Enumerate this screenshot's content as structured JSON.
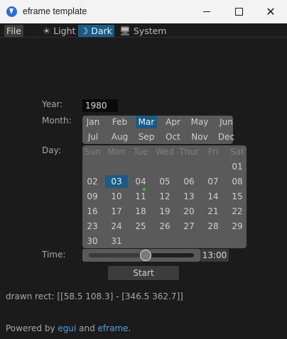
{
  "window": {
    "title": "eframe template"
  },
  "menu": {
    "file": "File",
    "themes": [
      {
        "label": "Light",
        "icon": "☀"
      },
      {
        "label": "Dark",
        "icon": "☽"
      },
      {
        "label": "System",
        "icon": "🖥"
      }
    ],
    "selected_theme": "Dark"
  },
  "form": {
    "year_label": "Year:",
    "year_value": "1980",
    "month_label": "Month:",
    "months": [
      "Jan",
      "Feb",
      "Mar",
      "Apr",
      "May",
      "Jun",
      "Jul",
      "Aug",
      "Sep",
      "Oct",
      "Nov",
      "Dec"
    ],
    "selected_month": "Mar",
    "day_label": "Day:",
    "weekdays": [
      "Sun",
      "Mon",
      "Tue",
      "Wed",
      "Thur",
      "Fri",
      "Sat"
    ],
    "days": [
      "01",
      "02",
      "03",
      "04",
      "05",
      "06",
      "07",
      "08",
      "09",
      "10",
      "11",
      "12",
      "13",
      "14",
      "15",
      "16",
      "17",
      "18",
      "19",
      "20",
      "21",
      "22",
      "23",
      "24",
      "25",
      "26",
      "27",
      "28",
      "29",
      "30",
      "31"
    ],
    "selected_day": "03",
    "today_day": "11",
    "time_label": "Time:",
    "time_value": "13:00",
    "time_fraction": 0.54,
    "start_label": "Start"
  },
  "drawn_rect_text": "drawn rect: [[58.5 108.3] - [346.5 362.7]]",
  "footer": {
    "prefix": "Powered by ",
    "link1": "egui",
    "middle": " and ",
    "link2": "eframe",
    "suffix": "."
  }
}
